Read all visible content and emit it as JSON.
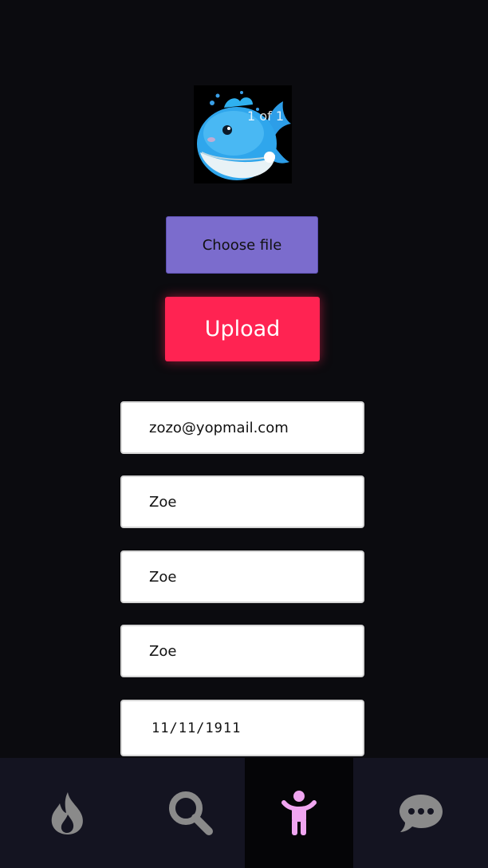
{
  "carousel": {
    "counter": "1 of 1",
    "image": "whale-emoji"
  },
  "upload_form": {
    "choose_file_label": "Choose file",
    "upload_label": "Upload"
  },
  "fields": {
    "email": "zozo@yopmail.com",
    "first_name": "Zoe",
    "last_name": "Zoe",
    "username": "Zoe",
    "birthdate": "11/11/1911"
  },
  "bottom_nav": {
    "items": [
      {
        "icon": "fire-icon",
        "active": false
      },
      {
        "icon": "search-icon",
        "active": false
      },
      {
        "icon": "person-icon",
        "active": true
      },
      {
        "icon": "chat-icon",
        "active": false
      }
    ]
  },
  "colors": {
    "background": "#0b0b0f",
    "choose_file": "#7b6ccd",
    "upload": "#ff2352",
    "nav_bar": "#141421",
    "nav_active_icon": "#f0a6f0",
    "nav_inactive_icon": "#8a8a8a"
  }
}
